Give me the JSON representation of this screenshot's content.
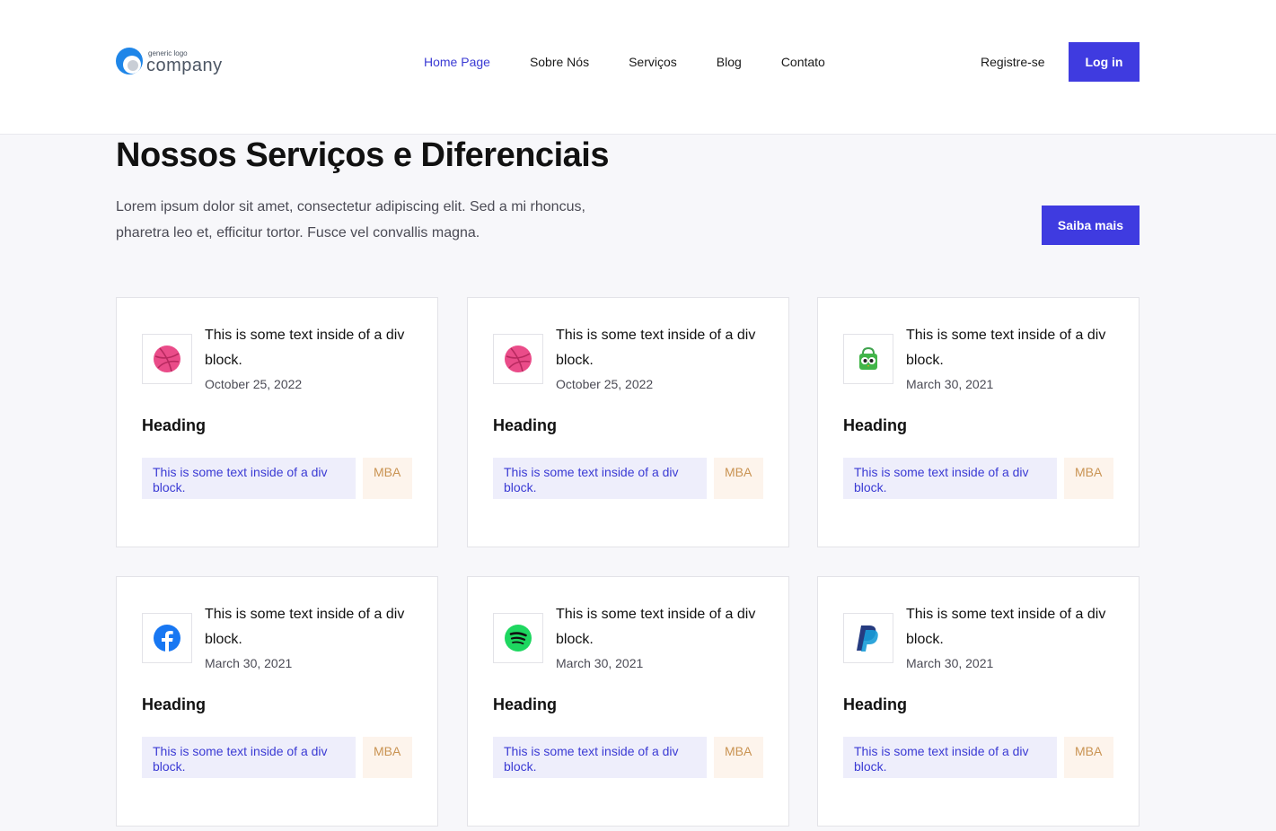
{
  "header": {
    "logo_small": "generic logo",
    "logo_big": "company",
    "nav": [
      "Home Page",
      "Sobre Nós",
      "Serviços",
      "Blog",
      "Contato"
    ],
    "register_label": "Registre-se",
    "login_label": "Log in"
  },
  "hero": {
    "title": "Nossos Serviços e Diferenciais",
    "description": "Lorem ipsum dolor sit amet, consectetur adipiscing elit. Sed a mi rhoncus, pharetra leo et, efficitur tortor. Fusce vel convallis magna.",
    "cta_label": "Saiba mais"
  },
  "colors": {
    "accent": "#3f3be0",
    "active_nav": "#3b3bd4",
    "badge_text": "#c99352"
  },
  "cards": [
    {
      "icon": "dribbble-icon",
      "title": "This is some text inside of a div block.",
      "date": "October 25, 2022",
      "heading": "Heading",
      "tag": "This is some text inside of a div block.",
      "badge": "MBA"
    },
    {
      "icon": "dribbble-icon",
      "title": "This is some text inside of a div block.",
      "date": "October 25, 2022",
      "heading": "Heading",
      "tag": "This is some text inside of a div block.",
      "badge": "MBA"
    },
    {
      "icon": "tokopedia-icon",
      "title": "This is some text inside of a div block.",
      "date": "March 30, 2021",
      "heading": "Heading",
      "tag": "This is some text inside of a div block.",
      "badge": "MBA"
    },
    {
      "icon": "facebook-icon",
      "title": "This is some text inside of a div block.",
      "date": "March 30, 2021",
      "heading": "Heading",
      "tag": "This is some text inside of a div block.",
      "badge": "MBA"
    },
    {
      "icon": "spotify-icon",
      "title": "This is some text inside of a div block.",
      "date": "March 30, 2021",
      "heading": "Heading",
      "tag": "This is some text inside of a div block.",
      "badge": "MBA"
    },
    {
      "icon": "paypal-icon",
      "title": "This is some text inside of a div block.",
      "date": "March 30, 2021",
      "heading": "Heading",
      "tag": "This is some text inside of a div block.",
      "badge": "MBA"
    }
  ]
}
